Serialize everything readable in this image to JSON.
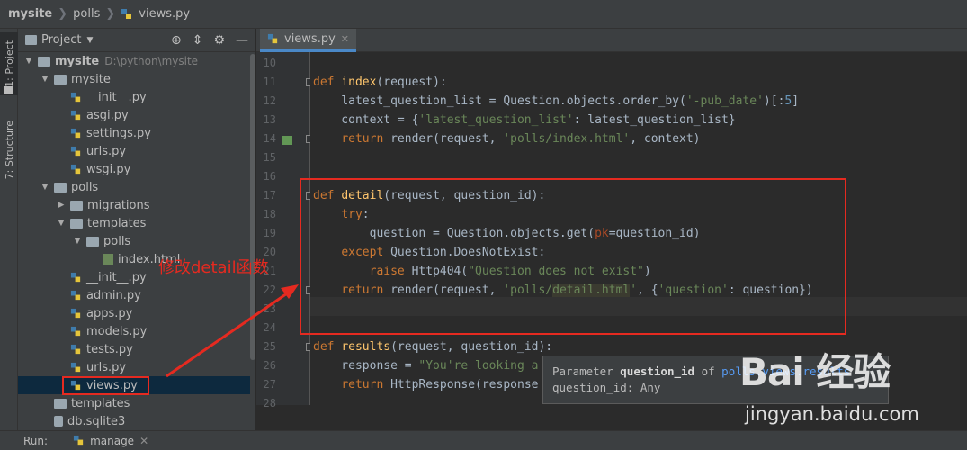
{
  "breadcrumb": {
    "project": "mysite",
    "folder": "polls",
    "file": "views.py"
  },
  "stripe": {
    "project_tab": "1: Project",
    "structure_tab": "7: Structure"
  },
  "project_panel": {
    "title": "Project",
    "tree": [
      {
        "label": "mysite",
        "hint": "D:\\python\\mysite",
        "kind": "folder",
        "depth": 0,
        "expanded": true
      },
      {
        "label": "mysite",
        "kind": "folder",
        "depth": 1,
        "expanded": true
      },
      {
        "label": "__init__.py",
        "kind": "py",
        "depth": 2
      },
      {
        "label": "asgi.py",
        "kind": "py",
        "depth": 2
      },
      {
        "label": "settings.py",
        "kind": "py",
        "depth": 2
      },
      {
        "label": "urls.py",
        "kind": "py",
        "depth": 2
      },
      {
        "label": "wsgi.py",
        "kind": "py",
        "depth": 2
      },
      {
        "label": "polls",
        "kind": "folder",
        "depth": 1,
        "expanded": true
      },
      {
        "label": "migrations",
        "kind": "folder",
        "depth": 2,
        "expanded": false
      },
      {
        "label": "templates",
        "kind": "folder",
        "depth": 2,
        "expanded": true
      },
      {
        "label": "polls",
        "kind": "folder",
        "depth": 3,
        "expanded": true
      },
      {
        "label": "index.html",
        "kind": "html",
        "depth": 4
      },
      {
        "label": "__init__.py",
        "kind": "py",
        "depth": 2
      },
      {
        "label": "admin.py",
        "kind": "py",
        "depth": 2
      },
      {
        "label": "apps.py",
        "kind": "py",
        "depth": 2
      },
      {
        "label": "models.py",
        "kind": "py",
        "depth": 2
      },
      {
        "label": "tests.py",
        "kind": "py",
        "depth": 2
      },
      {
        "label": "urls.py",
        "kind": "py",
        "depth": 2
      },
      {
        "label": "views.py",
        "kind": "py",
        "depth": 2,
        "selected": true
      },
      {
        "label": "templates",
        "kind": "folder",
        "depth": 1
      },
      {
        "label": "db.sqlite3",
        "kind": "db",
        "depth": 1
      }
    ]
  },
  "editor": {
    "tab_label": "views.py",
    "line_numbers": [
      "10",
      "11",
      "12",
      "13",
      "14",
      "15",
      "16",
      "17",
      "18",
      "19",
      "20",
      "21",
      "22",
      "23",
      "24",
      "25",
      "26",
      "27",
      "28"
    ]
  },
  "annotation": {
    "text": "修改detail函数",
    "color": "#e52a20"
  },
  "tooltip": {
    "prefix": "Parameter ",
    "param": "question_id",
    "mid": " of ",
    "link": "polls.views.results",
    "line2": "question_id: Any"
  },
  "watermark": {
    "logo": "Bai 经验",
    "url": "jingyan.baidu.com"
  },
  "runbar": {
    "label": "Run:",
    "config": "manage"
  },
  "colors": {
    "keyword": "#cc7832",
    "function": "#ffc66d",
    "string": "#6a8759",
    "number": "#6897bb",
    "accent": "#4a88c7"
  }
}
